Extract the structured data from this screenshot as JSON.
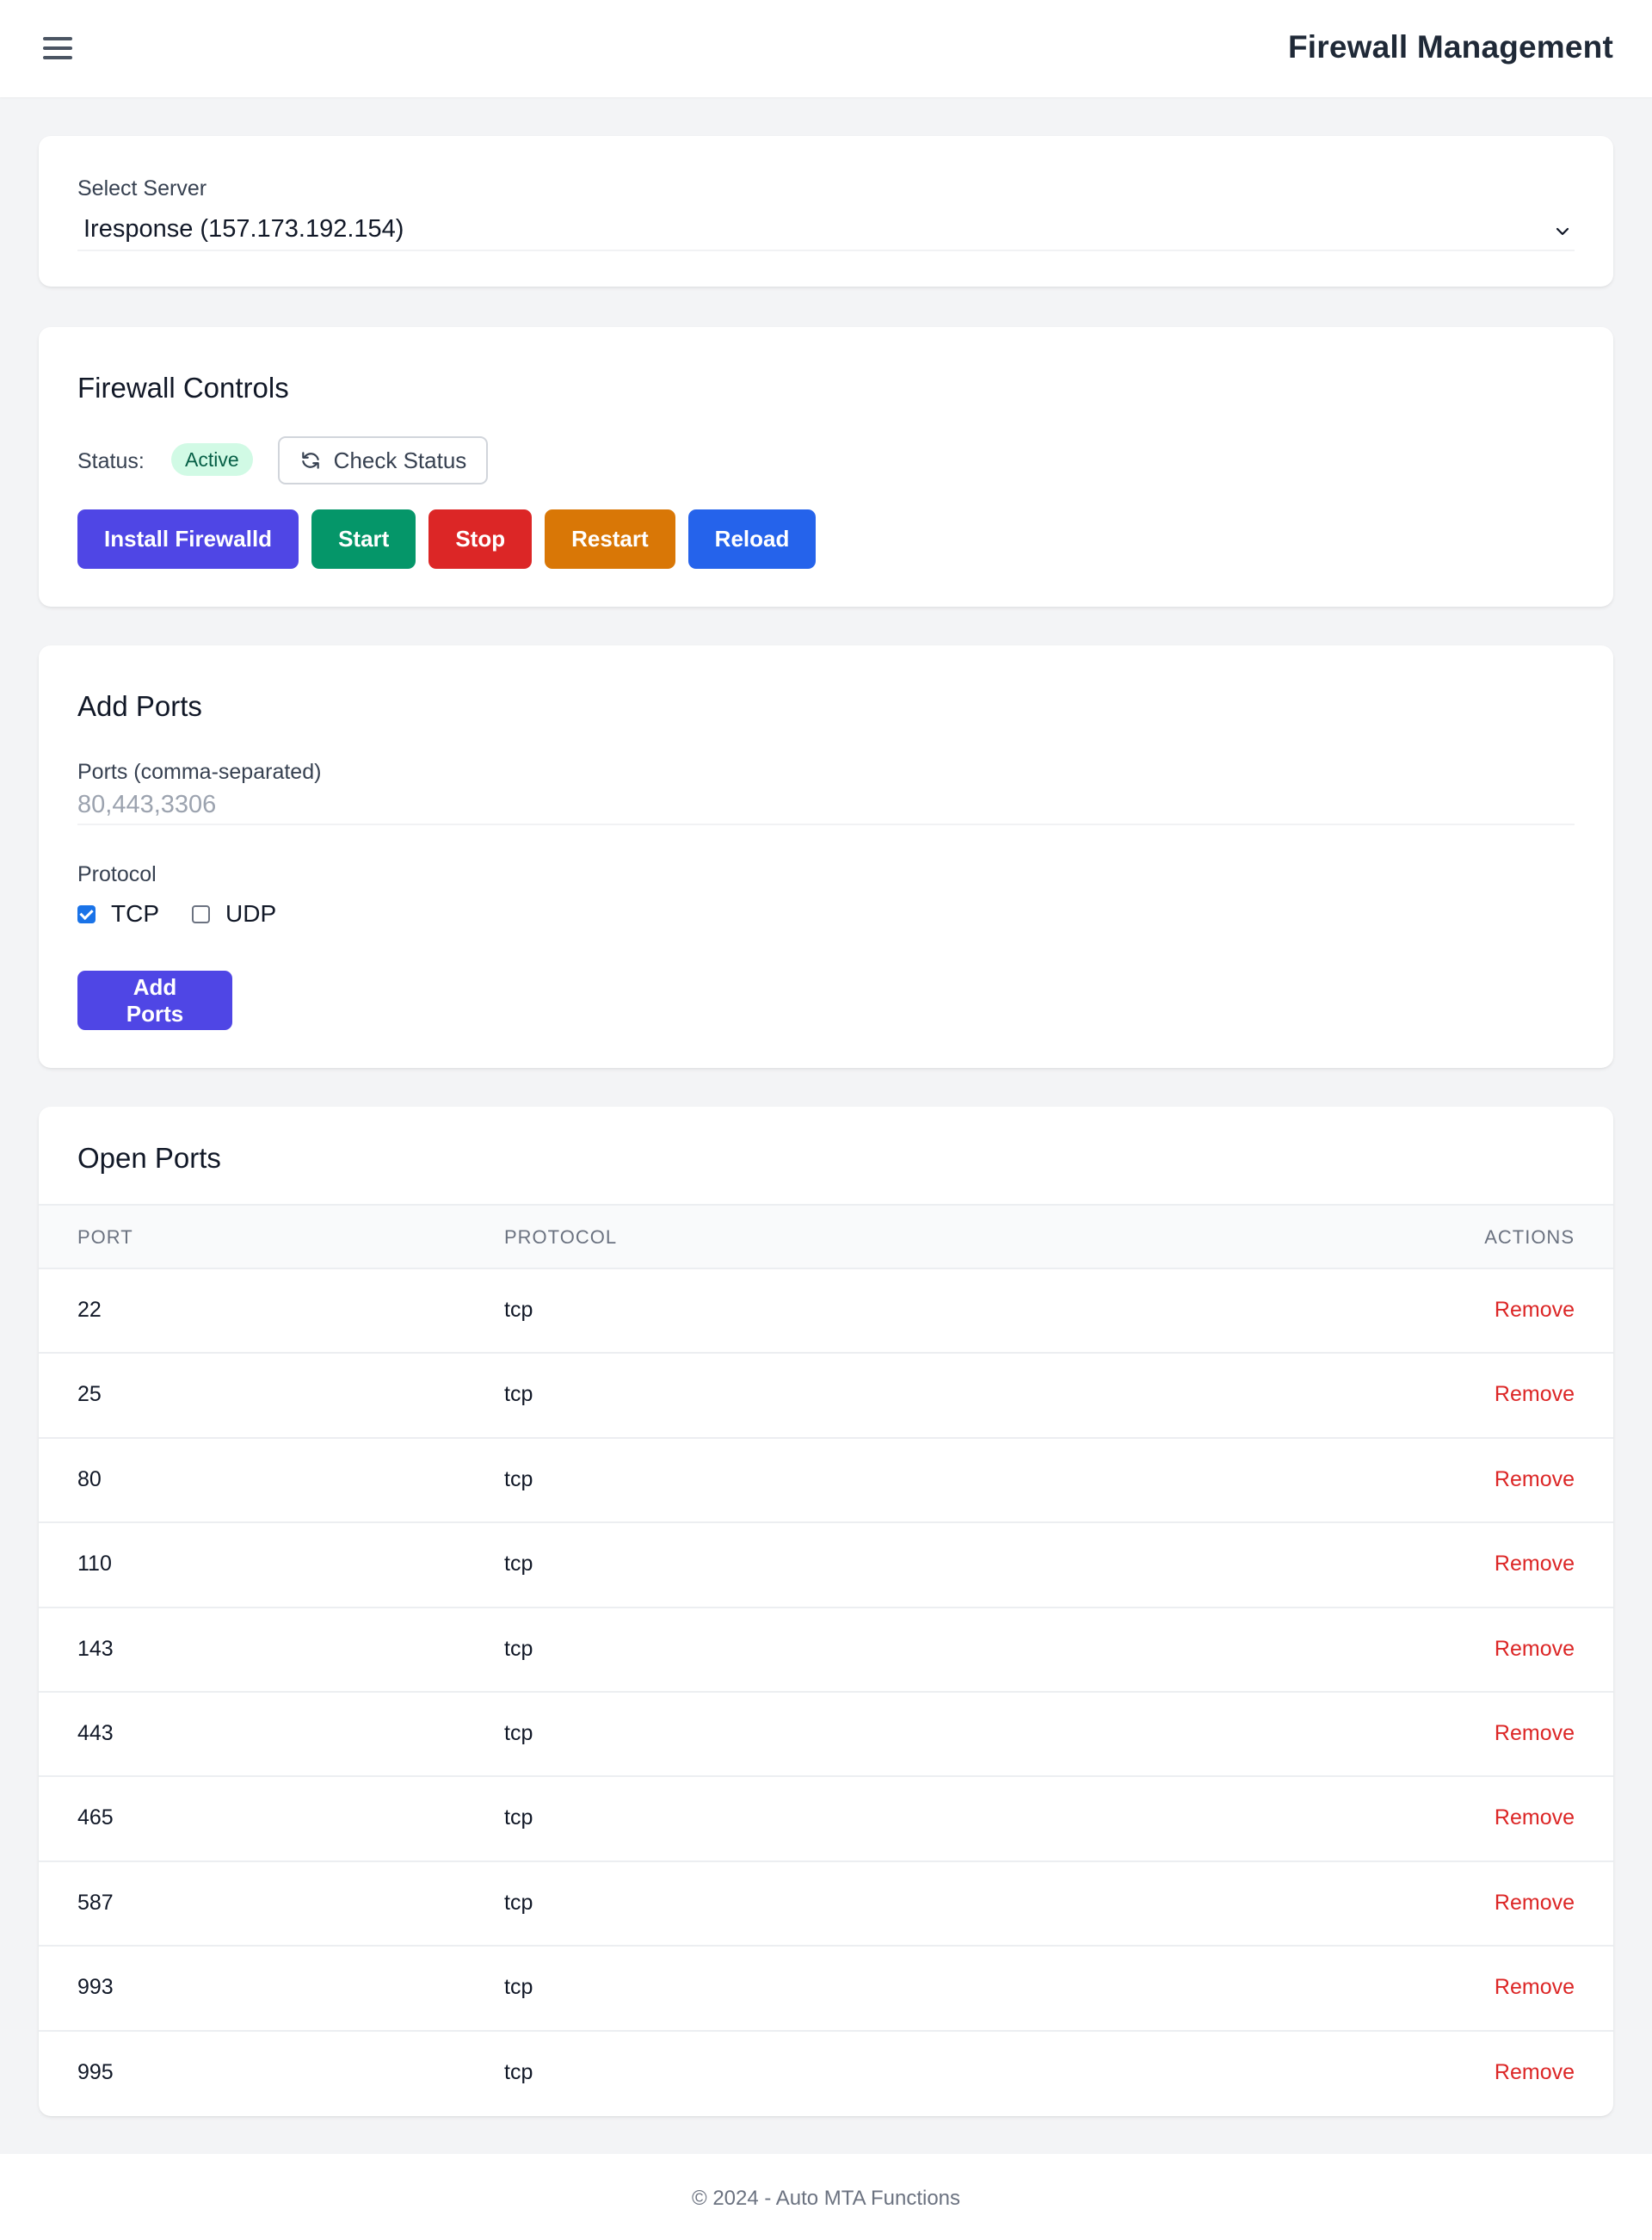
{
  "header": {
    "title": "Firewall Management",
    "menu_icon": "hamburger-menu-icon"
  },
  "server_select": {
    "label": "Select Server",
    "selected": "Iresponse (157.173.192.154)",
    "icon": "chevron-down-icon"
  },
  "controls": {
    "title": "Firewall Controls",
    "status_label": "Status:",
    "status_value": "Active",
    "check_status_label": "Check Status",
    "check_status_icon": "refresh-icon",
    "buttons": [
      {
        "label": "Install Firewalld",
        "color": "#4f46e5"
      },
      {
        "label": "Start",
        "color": "#059669"
      },
      {
        "label": "Stop",
        "color": "#dc2626"
      },
      {
        "label": "Restart",
        "color": "#d97706"
      },
      {
        "label": "Reload",
        "color": "#2563eb"
      }
    ]
  },
  "add_ports": {
    "title": "Add Ports",
    "ports_label": "Ports (comma-separated)",
    "ports_value": "",
    "ports_placeholder": "80,443,3306",
    "protocol_label": "Protocol",
    "protocols": [
      {
        "label": "TCP",
        "checked": true
      },
      {
        "label": "UDP",
        "checked": false
      }
    ],
    "submit_label": "Add Ports",
    "submit_color": "#4f46e5"
  },
  "open_ports": {
    "title": "Open Ports",
    "columns": [
      "PORT",
      "PROTOCOL",
      "ACTIONS"
    ],
    "action_label": "Remove",
    "rows": [
      {
        "port": "22",
        "protocol": "tcp"
      },
      {
        "port": "25",
        "protocol": "tcp"
      },
      {
        "port": "80",
        "protocol": "tcp"
      },
      {
        "port": "110",
        "protocol": "tcp"
      },
      {
        "port": "143",
        "protocol": "tcp"
      },
      {
        "port": "443",
        "protocol": "tcp"
      },
      {
        "port": "465",
        "protocol": "tcp"
      },
      {
        "port": "587",
        "protocol": "tcp"
      },
      {
        "port": "993",
        "protocol": "tcp"
      },
      {
        "port": "995",
        "protocol": "tcp"
      }
    ]
  },
  "footer": {
    "text": "© 2024 - Auto MTA Functions"
  }
}
